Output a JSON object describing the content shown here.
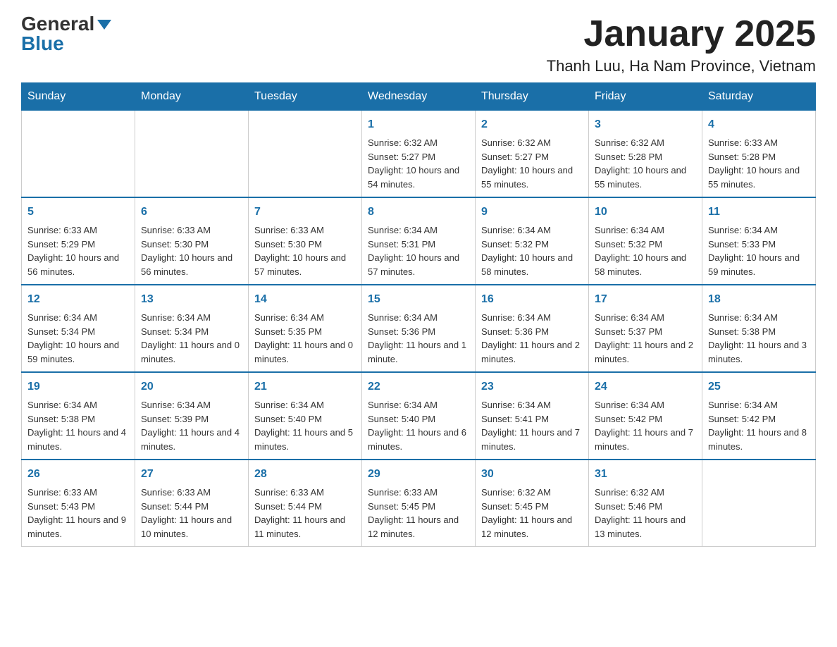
{
  "header": {
    "logo_general": "General",
    "logo_blue": "Blue",
    "month_title": "January 2025",
    "location": "Thanh Luu, Ha Nam Province, Vietnam"
  },
  "weekdays": [
    "Sunday",
    "Monday",
    "Tuesday",
    "Wednesday",
    "Thursday",
    "Friday",
    "Saturday"
  ],
  "weeks": [
    [
      {
        "day": "",
        "sunrise": "",
        "sunset": "",
        "daylight": ""
      },
      {
        "day": "",
        "sunrise": "",
        "sunset": "",
        "daylight": ""
      },
      {
        "day": "",
        "sunrise": "",
        "sunset": "",
        "daylight": ""
      },
      {
        "day": "1",
        "sunrise": "Sunrise: 6:32 AM",
        "sunset": "Sunset: 5:27 PM",
        "daylight": "Daylight: 10 hours and 54 minutes."
      },
      {
        "day": "2",
        "sunrise": "Sunrise: 6:32 AM",
        "sunset": "Sunset: 5:27 PM",
        "daylight": "Daylight: 10 hours and 55 minutes."
      },
      {
        "day": "3",
        "sunrise": "Sunrise: 6:32 AM",
        "sunset": "Sunset: 5:28 PM",
        "daylight": "Daylight: 10 hours and 55 minutes."
      },
      {
        "day": "4",
        "sunrise": "Sunrise: 6:33 AM",
        "sunset": "Sunset: 5:28 PM",
        "daylight": "Daylight: 10 hours and 55 minutes."
      }
    ],
    [
      {
        "day": "5",
        "sunrise": "Sunrise: 6:33 AM",
        "sunset": "Sunset: 5:29 PM",
        "daylight": "Daylight: 10 hours and 56 minutes."
      },
      {
        "day": "6",
        "sunrise": "Sunrise: 6:33 AM",
        "sunset": "Sunset: 5:30 PM",
        "daylight": "Daylight: 10 hours and 56 minutes."
      },
      {
        "day": "7",
        "sunrise": "Sunrise: 6:33 AM",
        "sunset": "Sunset: 5:30 PM",
        "daylight": "Daylight: 10 hours and 57 minutes."
      },
      {
        "day": "8",
        "sunrise": "Sunrise: 6:34 AM",
        "sunset": "Sunset: 5:31 PM",
        "daylight": "Daylight: 10 hours and 57 minutes."
      },
      {
        "day": "9",
        "sunrise": "Sunrise: 6:34 AM",
        "sunset": "Sunset: 5:32 PM",
        "daylight": "Daylight: 10 hours and 58 minutes."
      },
      {
        "day": "10",
        "sunrise": "Sunrise: 6:34 AM",
        "sunset": "Sunset: 5:32 PM",
        "daylight": "Daylight: 10 hours and 58 minutes."
      },
      {
        "day": "11",
        "sunrise": "Sunrise: 6:34 AM",
        "sunset": "Sunset: 5:33 PM",
        "daylight": "Daylight: 10 hours and 59 minutes."
      }
    ],
    [
      {
        "day": "12",
        "sunrise": "Sunrise: 6:34 AM",
        "sunset": "Sunset: 5:34 PM",
        "daylight": "Daylight: 10 hours and 59 minutes."
      },
      {
        "day": "13",
        "sunrise": "Sunrise: 6:34 AM",
        "sunset": "Sunset: 5:34 PM",
        "daylight": "Daylight: 11 hours and 0 minutes."
      },
      {
        "day": "14",
        "sunrise": "Sunrise: 6:34 AM",
        "sunset": "Sunset: 5:35 PM",
        "daylight": "Daylight: 11 hours and 0 minutes."
      },
      {
        "day": "15",
        "sunrise": "Sunrise: 6:34 AM",
        "sunset": "Sunset: 5:36 PM",
        "daylight": "Daylight: 11 hours and 1 minute."
      },
      {
        "day": "16",
        "sunrise": "Sunrise: 6:34 AM",
        "sunset": "Sunset: 5:36 PM",
        "daylight": "Daylight: 11 hours and 2 minutes."
      },
      {
        "day": "17",
        "sunrise": "Sunrise: 6:34 AM",
        "sunset": "Sunset: 5:37 PM",
        "daylight": "Daylight: 11 hours and 2 minutes."
      },
      {
        "day": "18",
        "sunrise": "Sunrise: 6:34 AM",
        "sunset": "Sunset: 5:38 PM",
        "daylight": "Daylight: 11 hours and 3 minutes."
      }
    ],
    [
      {
        "day": "19",
        "sunrise": "Sunrise: 6:34 AM",
        "sunset": "Sunset: 5:38 PM",
        "daylight": "Daylight: 11 hours and 4 minutes."
      },
      {
        "day": "20",
        "sunrise": "Sunrise: 6:34 AM",
        "sunset": "Sunset: 5:39 PM",
        "daylight": "Daylight: 11 hours and 4 minutes."
      },
      {
        "day": "21",
        "sunrise": "Sunrise: 6:34 AM",
        "sunset": "Sunset: 5:40 PM",
        "daylight": "Daylight: 11 hours and 5 minutes."
      },
      {
        "day": "22",
        "sunrise": "Sunrise: 6:34 AM",
        "sunset": "Sunset: 5:40 PM",
        "daylight": "Daylight: 11 hours and 6 minutes."
      },
      {
        "day": "23",
        "sunrise": "Sunrise: 6:34 AM",
        "sunset": "Sunset: 5:41 PM",
        "daylight": "Daylight: 11 hours and 7 minutes."
      },
      {
        "day": "24",
        "sunrise": "Sunrise: 6:34 AM",
        "sunset": "Sunset: 5:42 PM",
        "daylight": "Daylight: 11 hours and 7 minutes."
      },
      {
        "day": "25",
        "sunrise": "Sunrise: 6:34 AM",
        "sunset": "Sunset: 5:42 PM",
        "daylight": "Daylight: 11 hours and 8 minutes."
      }
    ],
    [
      {
        "day": "26",
        "sunrise": "Sunrise: 6:33 AM",
        "sunset": "Sunset: 5:43 PM",
        "daylight": "Daylight: 11 hours and 9 minutes."
      },
      {
        "day": "27",
        "sunrise": "Sunrise: 6:33 AM",
        "sunset": "Sunset: 5:44 PM",
        "daylight": "Daylight: 11 hours and 10 minutes."
      },
      {
        "day": "28",
        "sunrise": "Sunrise: 6:33 AM",
        "sunset": "Sunset: 5:44 PM",
        "daylight": "Daylight: 11 hours and 11 minutes."
      },
      {
        "day": "29",
        "sunrise": "Sunrise: 6:33 AM",
        "sunset": "Sunset: 5:45 PM",
        "daylight": "Daylight: 11 hours and 12 minutes."
      },
      {
        "day": "30",
        "sunrise": "Sunrise: 6:32 AM",
        "sunset": "Sunset: 5:45 PM",
        "daylight": "Daylight: 11 hours and 12 minutes."
      },
      {
        "day": "31",
        "sunrise": "Sunrise: 6:32 AM",
        "sunset": "Sunset: 5:46 PM",
        "daylight": "Daylight: 11 hours and 13 minutes."
      },
      {
        "day": "",
        "sunrise": "",
        "sunset": "",
        "daylight": ""
      }
    ]
  ]
}
